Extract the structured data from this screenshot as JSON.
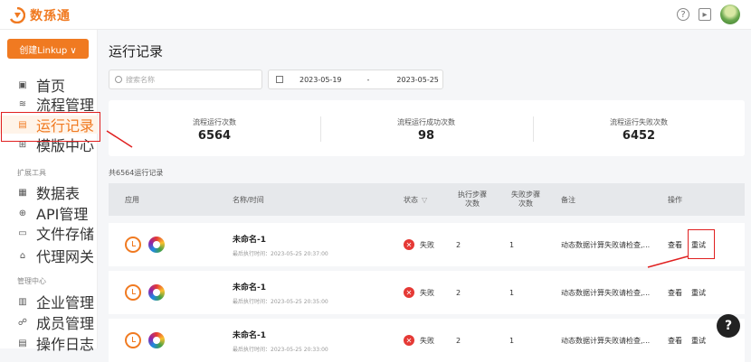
{
  "app": {
    "name": "数孫通",
    "brand_color": "#f07a21"
  },
  "topbar": {
    "help_icon": "question-circle-icon",
    "screen_icon": "monitor-icon"
  },
  "sidebar": {
    "create_button": "创建Linkup ∨",
    "items": [
      {
        "label": "首页",
        "icon": "home-icon"
      },
      {
        "label": "流程管理",
        "icon": "layers-icon"
      },
      {
        "label": "运行记录",
        "icon": "record-icon",
        "active": true
      },
      {
        "label": "模版中心",
        "icon": "grid-icon"
      }
    ],
    "section_extend": "扩展工具",
    "extend_items": [
      {
        "label": "数据表",
        "icon": "table-icon"
      },
      {
        "label": "API管理",
        "icon": "api-icon"
      },
      {
        "label": "文件存储",
        "icon": "folder-icon"
      },
      {
        "label": "代理网关",
        "icon": "gateway-icon"
      }
    ],
    "section_manage": "管理中心",
    "manage_items": [
      {
        "label": "企业管理",
        "icon": "building-icon"
      },
      {
        "label": "成员管理",
        "icon": "users-icon"
      },
      {
        "label": "操作日志",
        "icon": "log-icon"
      }
    ]
  },
  "main": {
    "title": "运行记录",
    "search_placeholder": "搜索名称",
    "date_from": "2023-05-19",
    "date_sep": "-",
    "date_to": "2023-05-25",
    "stats": [
      {
        "label": "流程运行次数",
        "value": "6564"
      },
      {
        "label": "流程运行成功次数",
        "value": "98"
      },
      {
        "label": "流程运行失败次数",
        "value": "6452"
      }
    ],
    "total_text": "共6564运行记录",
    "columns": {
      "app": "应用",
      "name_time": "名称/时间",
      "status": "状态",
      "exec_steps": "执行步骤次数",
      "fail_steps": "失败步骤次数",
      "note": "备注",
      "action": "操作"
    },
    "rows": [
      {
        "name": "未命名-1",
        "time": "最后执行时间：2023-05-25 20:37:00",
        "status": "失败",
        "exec": "2",
        "fail": "1",
        "note": "动态数据计算失败请检查,...",
        "view": "查看",
        "retry": "重试"
      },
      {
        "name": "未命名-1",
        "time": "最后执行时间：2023-05-25 20:35:00",
        "status": "失败",
        "exec": "2",
        "fail": "1",
        "note": "动态数据计算失败请检查,...",
        "view": "查看",
        "retry": "重试"
      },
      {
        "name": "未命名-1",
        "time": "最后执行时间：2023-05-25 20:33:00",
        "status": "失败",
        "exec": "2",
        "fail": "1",
        "note": "动态数据计算失败请检查,...",
        "view": "查看",
        "retry": "重试"
      }
    ]
  },
  "annotation_color": "#e02020"
}
